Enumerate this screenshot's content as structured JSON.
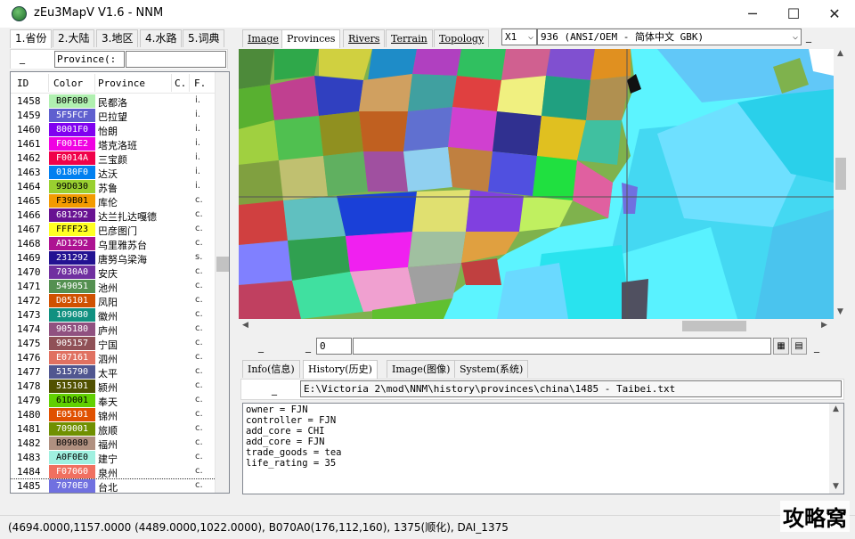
{
  "window": {
    "title": "zEu3MapV V1.6 - NNM",
    "minimize": "─",
    "maximize": "☐",
    "close": "✕",
    "icon": "globe-icon"
  },
  "left_tabs": [
    "1.省份",
    "2.大陆",
    "3.地区",
    "4.水路",
    "5.词典"
  ],
  "filter": {
    "prefix": "_",
    "select_value": "Province(:",
    "input_value": ""
  },
  "list": {
    "columns": [
      "ID",
      "Color",
      "Province",
      "C.",
      "F."
    ],
    "rows": [
      {
        "id": "1458",
        "color_hex": "B0F0B0",
        "name": "民都洛",
        "f": "i."
      },
      {
        "id": "1459",
        "color_hex": "5F5FCF",
        "name": "巴拉望",
        "f": "i."
      },
      {
        "id": "1460",
        "color_hex": "8001F0",
        "name": "怡朗",
        "f": "i."
      },
      {
        "id": "1461",
        "color_hex": "F001E2",
        "name": "塔克洛班",
        "f": "i."
      },
      {
        "id": "1462",
        "color_hex": "F0014A",
        "name": "三宝颜",
        "f": "i."
      },
      {
        "id": "1463",
        "color_hex": "0180F0",
        "name": "达沃",
        "f": "i."
      },
      {
        "id": "1464",
        "color_hex": "99D030",
        "name": "苏鲁",
        "f": "i."
      },
      {
        "id": "1465",
        "color_hex": "F39B01",
        "name": "库伦",
        "f": "c."
      },
      {
        "id": "1466",
        "color_hex": "681292",
        "name": "达兰扎达嘎德",
        "f": "c."
      },
      {
        "id": "1467",
        "color_hex": "FFFF23",
        "name": "巴彦图门",
        "f": "c."
      },
      {
        "id": "1468",
        "color_hex": "AD1292",
        "name": "乌里雅苏台",
        "f": "c."
      },
      {
        "id": "1469",
        "color_hex": "231292",
        "name": "唐努乌梁海",
        "f": "s."
      },
      {
        "id": "1470",
        "color_hex": "7030A0",
        "name": "安庆",
        "f": "c."
      },
      {
        "id": "1471",
        "color_hex": "549051",
        "name": "池州",
        "f": "c."
      },
      {
        "id": "1472",
        "color_hex": "D05101",
        "name": "凤阳",
        "f": "c."
      },
      {
        "id": "1473",
        "color_hex": "109080",
        "name": "徽州",
        "f": "c."
      },
      {
        "id": "1474",
        "color_hex": "905180",
        "name": "庐州",
        "f": "c."
      },
      {
        "id": "1475",
        "color_hex": "905157",
        "name": "宁国",
        "f": "c."
      },
      {
        "id": "1476",
        "color_hex": "E07161",
        "name": "泗州",
        "f": "c."
      },
      {
        "id": "1477",
        "color_hex": "515790",
        "name": "太平",
        "f": "c."
      },
      {
        "id": "1478",
        "color_hex": "515101",
        "name": "颍州",
        "f": "c."
      },
      {
        "id": "1479",
        "color_hex": "61D001",
        "name": "奉天",
        "f": "c."
      },
      {
        "id": "1480",
        "color_hex": "E05101",
        "name": "锦州",
        "f": "c."
      },
      {
        "id": "1481",
        "color_hex": "709001",
        "name": "旅顺",
        "f": "c."
      },
      {
        "id": "1482",
        "color_hex": "B09080",
        "name": "福州",
        "f": "c."
      },
      {
        "id": "1483",
        "color_hex": "A0F0E0",
        "name": "建宁",
        "f": "c."
      },
      {
        "id": "1484",
        "color_hex": "F07060",
        "name": "泉州",
        "f": "c."
      },
      {
        "id": "1485",
        "color_hex": "7070E0",
        "name": "台北",
        "f": "c.",
        "selected": true
      }
    ]
  },
  "map_tabs": [
    "Image",
    "Provinces",
    "Rivers",
    "Terrain",
    "Topology"
  ],
  "zoom": "X1",
  "codepage": "936   (ANSI/OEM - 简体中文 GBK)",
  "toolbar": {
    "underscore": "_",
    "number_value": "0",
    "text_value": ""
  },
  "info_tabs": [
    "Info(信息)",
    "History(历史)",
    "Image(图像)",
    "System(系统)"
  ],
  "file_path": "E:\\Victoria 2\\mod\\NNM\\history\\provinces\\china\\1485 - Taibei.txt",
  "history_text": "owner = FJN\ncontroller = FJN\nadd_core = CHI\nadd_core = FJN\ntrade_goods = tea\nlife_rating = 35",
  "status": "(4694.0000,1157.0000 (4489.0000,1022.0000), B070A0(176,112,160), 1375(顺化), DAI_1375",
  "watermark": "攻略窝"
}
